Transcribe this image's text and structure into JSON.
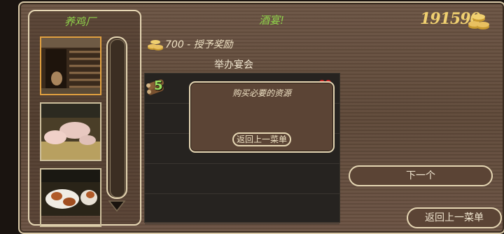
{
  "left_panel": {
    "title": "养鸡厂",
    "thumbnails": [
      {
        "name": "barn",
        "selected": true
      },
      {
        "name": "pigs",
        "selected": false
      },
      {
        "name": "cows",
        "selected": false
      }
    ]
  },
  "header": {
    "title": "酒宴!",
    "coins": "191590"
  },
  "reward": {
    "text": "700 - 授予奖励"
  },
  "event": {
    "label": "举办宴会"
  },
  "list": {
    "item_count": "5"
  },
  "dialog": {
    "message": "购买必要的资源",
    "back_button": "返回上一菜单"
  },
  "buttons": {
    "next": "下一个",
    "back": "返回上一菜单"
  },
  "colors": {
    "accent_green": "#8fd14a",
    "gold": "#f0d070",
    "border_cream": "#e6d7b4"
  }
}
